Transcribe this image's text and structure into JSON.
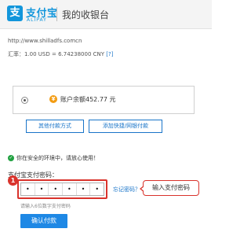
{
  "brand": {
    "logo_glyph": "支",
    "name": "支付宝",
    "sub": "ALIPAY",
    "divider": "|",
    "page_title": "我的收银台",
    "color": "#1296db"
  },
  "merchant": {
    "url": "http://www.shilladfs.comcn"
  },
  "exchange": {
    "label": "汇率：",
    "value": "1.00 USD = 6.74238000 CNY",
    "help": "[?]"
  },
  "balance": {
    "icon": "coin-icon",
    "icon_glyph": "¥",
    "label": "账户余额",
    "amount": "452.77 元"
  },
  "buttons": {
    "other_methods": "其他付款方式",
    "add_card": "添加快捷/网银付款",
    "confirm": "确认付款"
  },
  "security": {
    "check_glyph": "✓",
    "message": "你在安全的环境中，请放心使用！"
  },
  "password": {
    "label": "支付宝支付密码：",
    "step": "1",
    "dots": [
      "•",
      "•",
      "•",
      "•",
      "•",
      "•"
    ],
    "forgot": "忘记密码？",
    "hint": "请输入6位数字支付密码",
    "callout": "输入支付密码"
  },
  "colors": {
    "accent_blue": "#1a75c9",
    "highlight_red": "#d9332c",
    "button_blue": "#1e88e5"
  }
}
